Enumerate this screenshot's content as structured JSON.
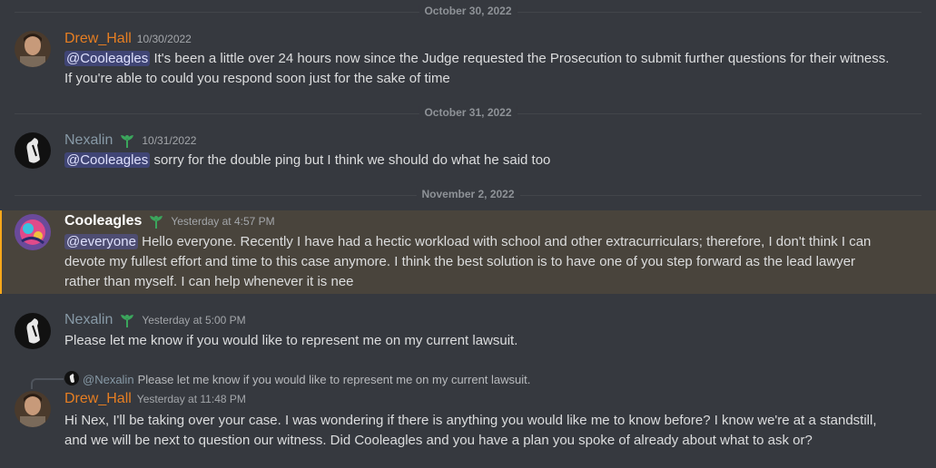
{
  "dividers": [
    "October 30, 2022",
    "October 31, 2022",
    "November 2, 2022"
  ],
  "messages": [
    {
      "author": "Drew_Hall",
      "timestamp": "10/30/2022",
      "mention": "@Cooleagles",
      "text": " It's been a little over 24 hours now since the Judge requested the Prosecution to submit further questions for their witness.",
      "text2": "If you're able to could you respond soon just for the sake of time"
    },
    {
      "author": "Nexalin",
      "timestamp": "10/31/2022",
      "mention": "@Cooleagles",
      "text": " sorry for the double ping but I think we should do what he said too"
    },
    {
      "author": "Cooleagles",
      "timestamp": "Yesterday at 4:57 PM",
      "mention": "@everyone",
      "text": " Hello everyone. Recently I have had a hectic workload with school and other extracurriculars; therefore, I don't think I can",
      "text2": "devote my fullest effort and time to this case anymore. I think the best solution is to have one of you step forward as the lead lawyer",
      "text3": "rather than myself. I can help whenever it is nee"
    },
    {
      "author": "Nexalin",
      "timestamp": "Yesterday at 5:00 PM",
      "text": "Please let me know if you would like to represent me on my current lawsuit."
    },
    {
      "reply": {
        "name": "@Nexalin",
        "text": "Please let me know if you would like to represent me on my current lawsuit."
      },
      "author": "Drew_Hall",
      "timestamp": "Yesterday at 11:48 PM",
      "text": "Hi Nex, I'll be taking over your case. I was wondering if there is anything you would like me to know before? I know we're at a standstill,",
      "text2": "and we will be next to question our witness. Did Cooleagles and you have a plan you spoke of already about what to ask or?"
    }
  ],
  "icons": {
    "badge": "sprout-badge-icon",
    "reply_avatar": "nexalin-mini-avatar-icon"
  },
  "colors": {
    "background": "#36393f",
    "mention_highlight": "#49443c",
    "mention_bar": "#faa81a",
    "drew_name": "#e67e22",
    "nexalin_name": "#8799a6",
    "badge": "#3ba55c"
  }
}
